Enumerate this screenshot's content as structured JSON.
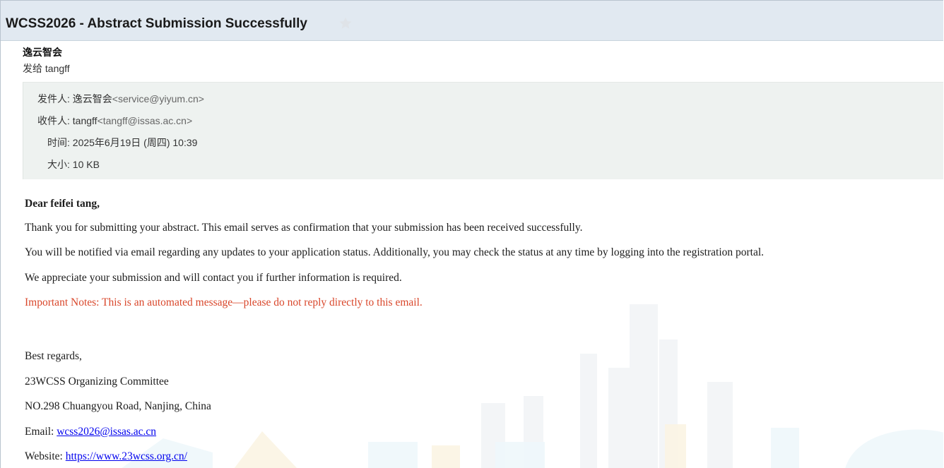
{
  "email": {
    "subject": "WCSS2026 - Abstract Submission Successfully",
    "sender_name": "逸云智会",
    "sent_to": "发给 tangff",
    "meta": {
      "from_label": "发件人:",
      "from_name": "逸云智会",
      "from_addr": "<service@yiyum.cn>",
      "to_label": "收件人:",
      "to_name": "tangff",
      "to_addr": "<tangff@issas.ac.cn>",
      "time_label": "时间:",
      "time_value": "2025年6月19日 (周四) 10:39",
      "size_label": "大小:",
      "size_value": "10 KB"
    },
    "body": {
      "greeting": "Dear feifei tang,",
      "p1": "Thank you for submitting your abstract. This email serves as confirmation that your submission has been received successfully.",
      "p2": "You will be notified via email regarding any updates to your application status. Additionally, you may check the status at any time by logging into the registration portal.",
      "p3": "We appreciate your submission and will contact you if further information is required.",
      "notice": "Important Notes: This is an automated message—please do not reply directly to this email.",
      "regards": "Best regards,",
      "committee": "23WCSS Organizing Committee",
      "address": "NO.298 Chuangyou Road, Nanjing, China",
      "email_label": "Email: ",
      "email_link": "wcss2026@issas.ac.cn",
      "website_label": "Website: ",
      "website_link": "https://www.23wcss.org.cn/"
    }
  },
  "colors": {
    "subject_bar": "#e1e9f1",
    "meta_bg": "#eef2f0",
    "notice": "#d9472b",
    "link": "#0000ee",
    "star": "#dfe3e8"
  },
  "icons": {
    "star": "star-icon"
  }
}
